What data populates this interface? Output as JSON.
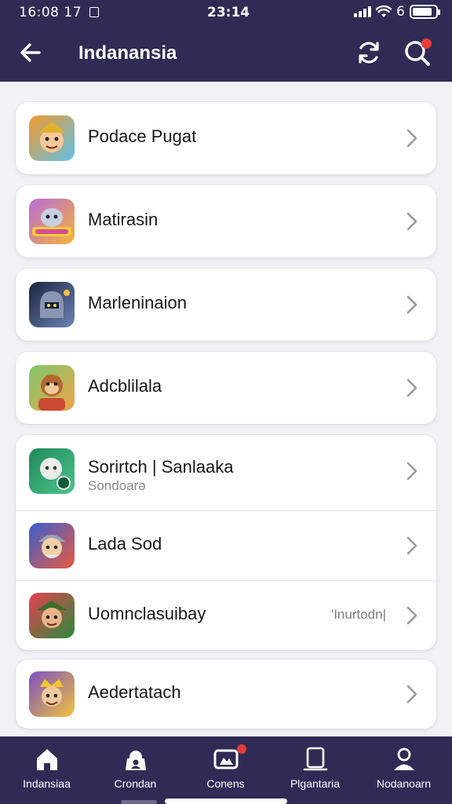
{
  "status_bar": {
    "left_text": "16:08 17",
    "time": "23:14",
    "battery_number": "6",
    "battery_level": 0.85
  },
  "app_bar": {
    "title": "Indanansia",
    "back_icon": "arrow-left-icon",
    "refresh_icon": "refresh-icon",
    "search_icon": "search-icon"
  },
  "items": [
    {
      "name": "Podace Pugat",
      "icon": "warrior-character-icon",
      "colors": [
        "#f39a2e",
        "#5fc1e8"
      ]
    },
    {
      "name": "Matirasin",
      "icon": "creature-gumdrops-icon",
      "colors": [
        "#b86bd6",
        "#f5b23a"
      ]
    },
    {
      "name": "Marleninaion",
      "icon": "armored-knight-icon",
      "colors": [
        "#1c2440",
        "#6c84b4"
      ]
    },
    {
      "name": "Adcblilala",
      "icon": "monkey-character-icon",
      "colors": [
        "#7cc96b",
        "#f0a24a"
      ]
    },
    {
      "name": "Sorirtch | Sanlaaka",
      "sub": "Sondoarə",
      "icon": "green-ghost-icon",
      "colors": [
        "#1f8a5a",
        "#4cc28a"
      ]
    },
    {
      "name": "Lada Sod",
      "icon": "viking-hero-icon",
      "colors": [
        "#3a5fcf",
        "#e85a3f"
      ]
    },
    {
      "name": "Uomnclasuibay",
      "meta": "'Inurtodn|",
      "icon": "ranger-hero-icon",
      "colors": [
        "#e8404f",
        "#2a8b3c"
      ]
    },
    {
      "name": "Aedertatach",
      "icon": "golden-king-icon",
      "colors": [
        "#7b4fc4",
        "#f2c23c"
      ]
    }
  ],
  "bottom_nav": [
    {
      "label": "Indansiaa",
      "icon": "home-icon"
    },
    {
      "label": "Crondan",
      "icon": "lock-user-icon"
    },
    {
      "label": "Conens",
      "icon": "chat-game-icon",
      "badge": true
    },
    {
      "label": "Plgantaria",
      "icon": "tablet-icon"
    },
    {
      "label": "Nodanoarn",
      "icon": "profile-icon"
    }
  ],
  "colors": {
    "primary": "#2f2b55",
    "background": "#f2f1f4",
    "badge": "#e53b3b",
    "card": "#ffffff"
  }
}
